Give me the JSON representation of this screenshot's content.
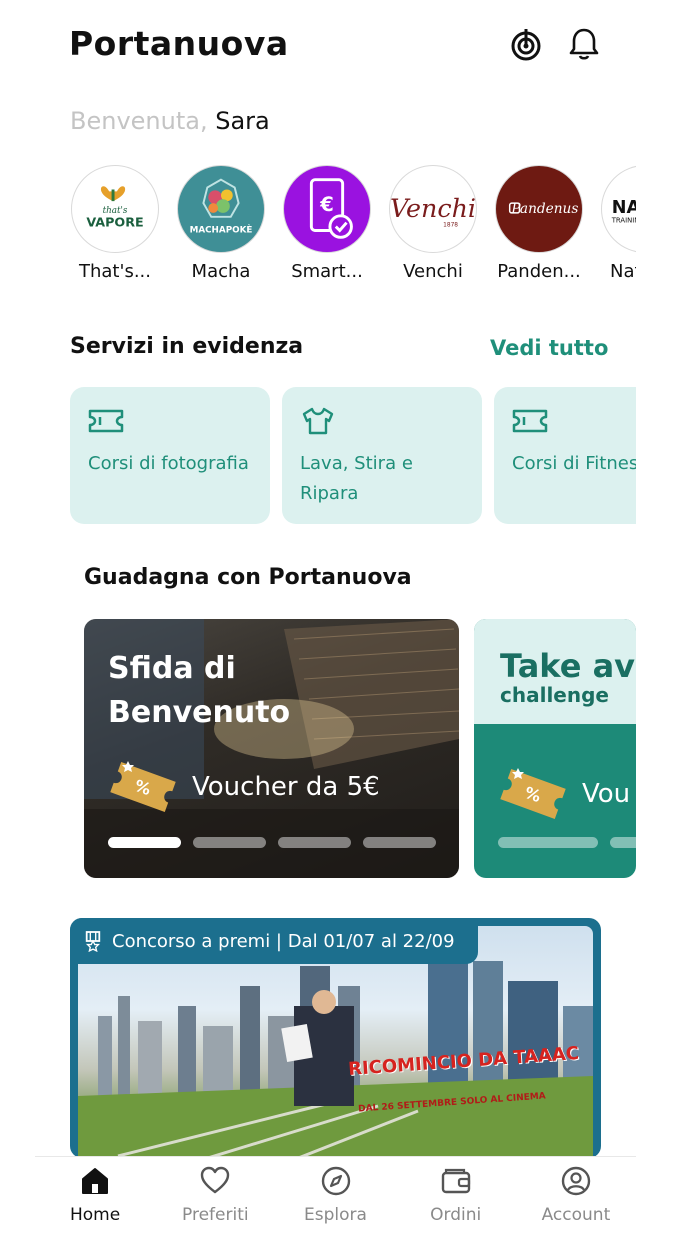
{
  "header": {
    "title": "Portanuova",
    "target_icon": "target-icon",
    "bell_icon": "bell-icon"
  },
  "welcome": {
    "greeting": "Benvenuta,",
    "name": "Sara"
  },
  "stores": [
    {
      "name": "That's...",
      "logo_text": "that's VAPORE",
      "color": "#ffffff"
    },
    {
      "name": "Macha",
      "logo_text": "MACHAPOKÈ",
      "color": "#3f8f96"
    },
    {
      "name": "Smart...",
      "logo_text": "€",
      "color": "#9a12e0"
    },
    {
      "name": "Venchi",
      "logo_text": "Venchi",
      "color": "#ffffff"
    },
    {
      "name": "Panden...",
      "logo_text": "Pandenus",
      "color": "#6e1a12"
    },
    {
      "name": "Nat",
      "logo_text": "NAT",
      "color": "#ffffff"
    }
  ],
  "servizi": {
    "title": "Servizi in evidenza",
    "see_all": "Vedi tutto",
    "items": [
      {
        "label": "Corsi di fotografia",
        "icon": "ticket-icon"
      },
      {
        "label": "Lava, Stira e Ripara",
        "icon": "shirt-icon"
      },
      {
        "label": "Corsi di Fitness",
        "icon": "ticket-icon"
      }
    ]
  },
  "guadagna": {
    "title": "Guadagna con Portanuova",
    "cards": [
      {
        "title": "Sfida di Benvenuto",
        "voucher": "Voucher da 5€"
      },
      {
        "title": "Take av",
        "subtitle": "challenge",
        "voucher": "Vou"
      }
    ]
  },
  "contest": {
    "label": "Concorso a premi | Dal 01/07 al 22/09",
    "movie_title": "RICOMINCIO DA TAAAC",
    "movie_sub": "DAL 26 SETTEMBRE SOLO AL CINEMA"
  },
  "nav": [
    {
      "label": "Home",
      "icon": "home-icon",
      "active": true
    },
    {
      "label": "Preferiti",
      "icon": "heart-icon",
      "active": false
    },
    {
      "label": "Esplora",
      "icon": "compass-icon",
      "active": false
    },
    {
      "label": "Ordini",
      "icon": "wallet-icon",
      "active": false
    },
    {
      "label": "Account",
      "icon": "account-icon",
      "active": false
    }
  ],
  "colors": {
    "accent": "#1f8f7a",
    "card_bg": "#dcf1ef",
    "contest_bg": "#1c6f8e"
  }
}
